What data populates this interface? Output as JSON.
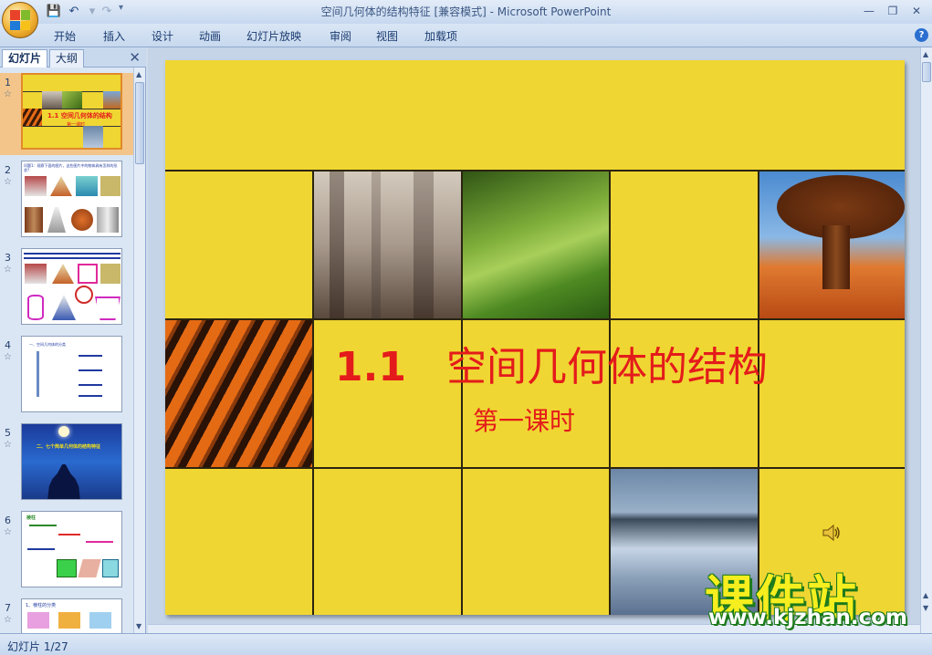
{
  "window": {
    "title": "空间几何体的结构特征 [兼容模式] - Microsoft PowerPoint"
  },
  "ribbon": {
    "tabs": [
      "开始",
      "插入",
      "设计",
      "动画",
      "幻灯片放映",
      "审阅",
      "视图",
      "加载项"
    ]
  },
  "pane": {
    "tabs": [
      "幻灯片",
      "大纲"
    ],
    "slides": [
      {
        "num": "1",
        "title": "1.1  空间几何体的结构",
        "sub": "第一课时"
      },
      {
        "num": "2",
        "title": "问题1：观察下面的图片，这些图片中的物体具有怎样的形状?"
      },
      {
        "num": "3",
        "title": ""
      },
      {
        "num": "4",
        "title": "一、空间几何体的分类"
      },
      {
        "num": "5",
        "title": "二、七个简单几何体的结构特征"
      },
      {
        "num": "6",
        "title": "棱柱"
      },
      {
        "num": "7",
        "title": "1、棱柱的分类"
      }
    ]
  },
  "slide": {
    "title_number": "1.1",
    "title_text": "空间几何体的结构",
    "subtitle": "第一课时",
    "background_color": "#f0d632",
    "title_color": "#e41b1b"
  },
  "status": {
    "slide_counter": "幻灯片 1/27"
  },
  "watermark": {
    "name": "课件站",
    "url": "www.kjzhan.com"
  },
  "icons": {
    "sound": "speaker-icon",
    "save": "save-icon",
    "undo": "undo-icon",
    "redo": "redo-icon",
    "help": "help-icon"
  }
}
